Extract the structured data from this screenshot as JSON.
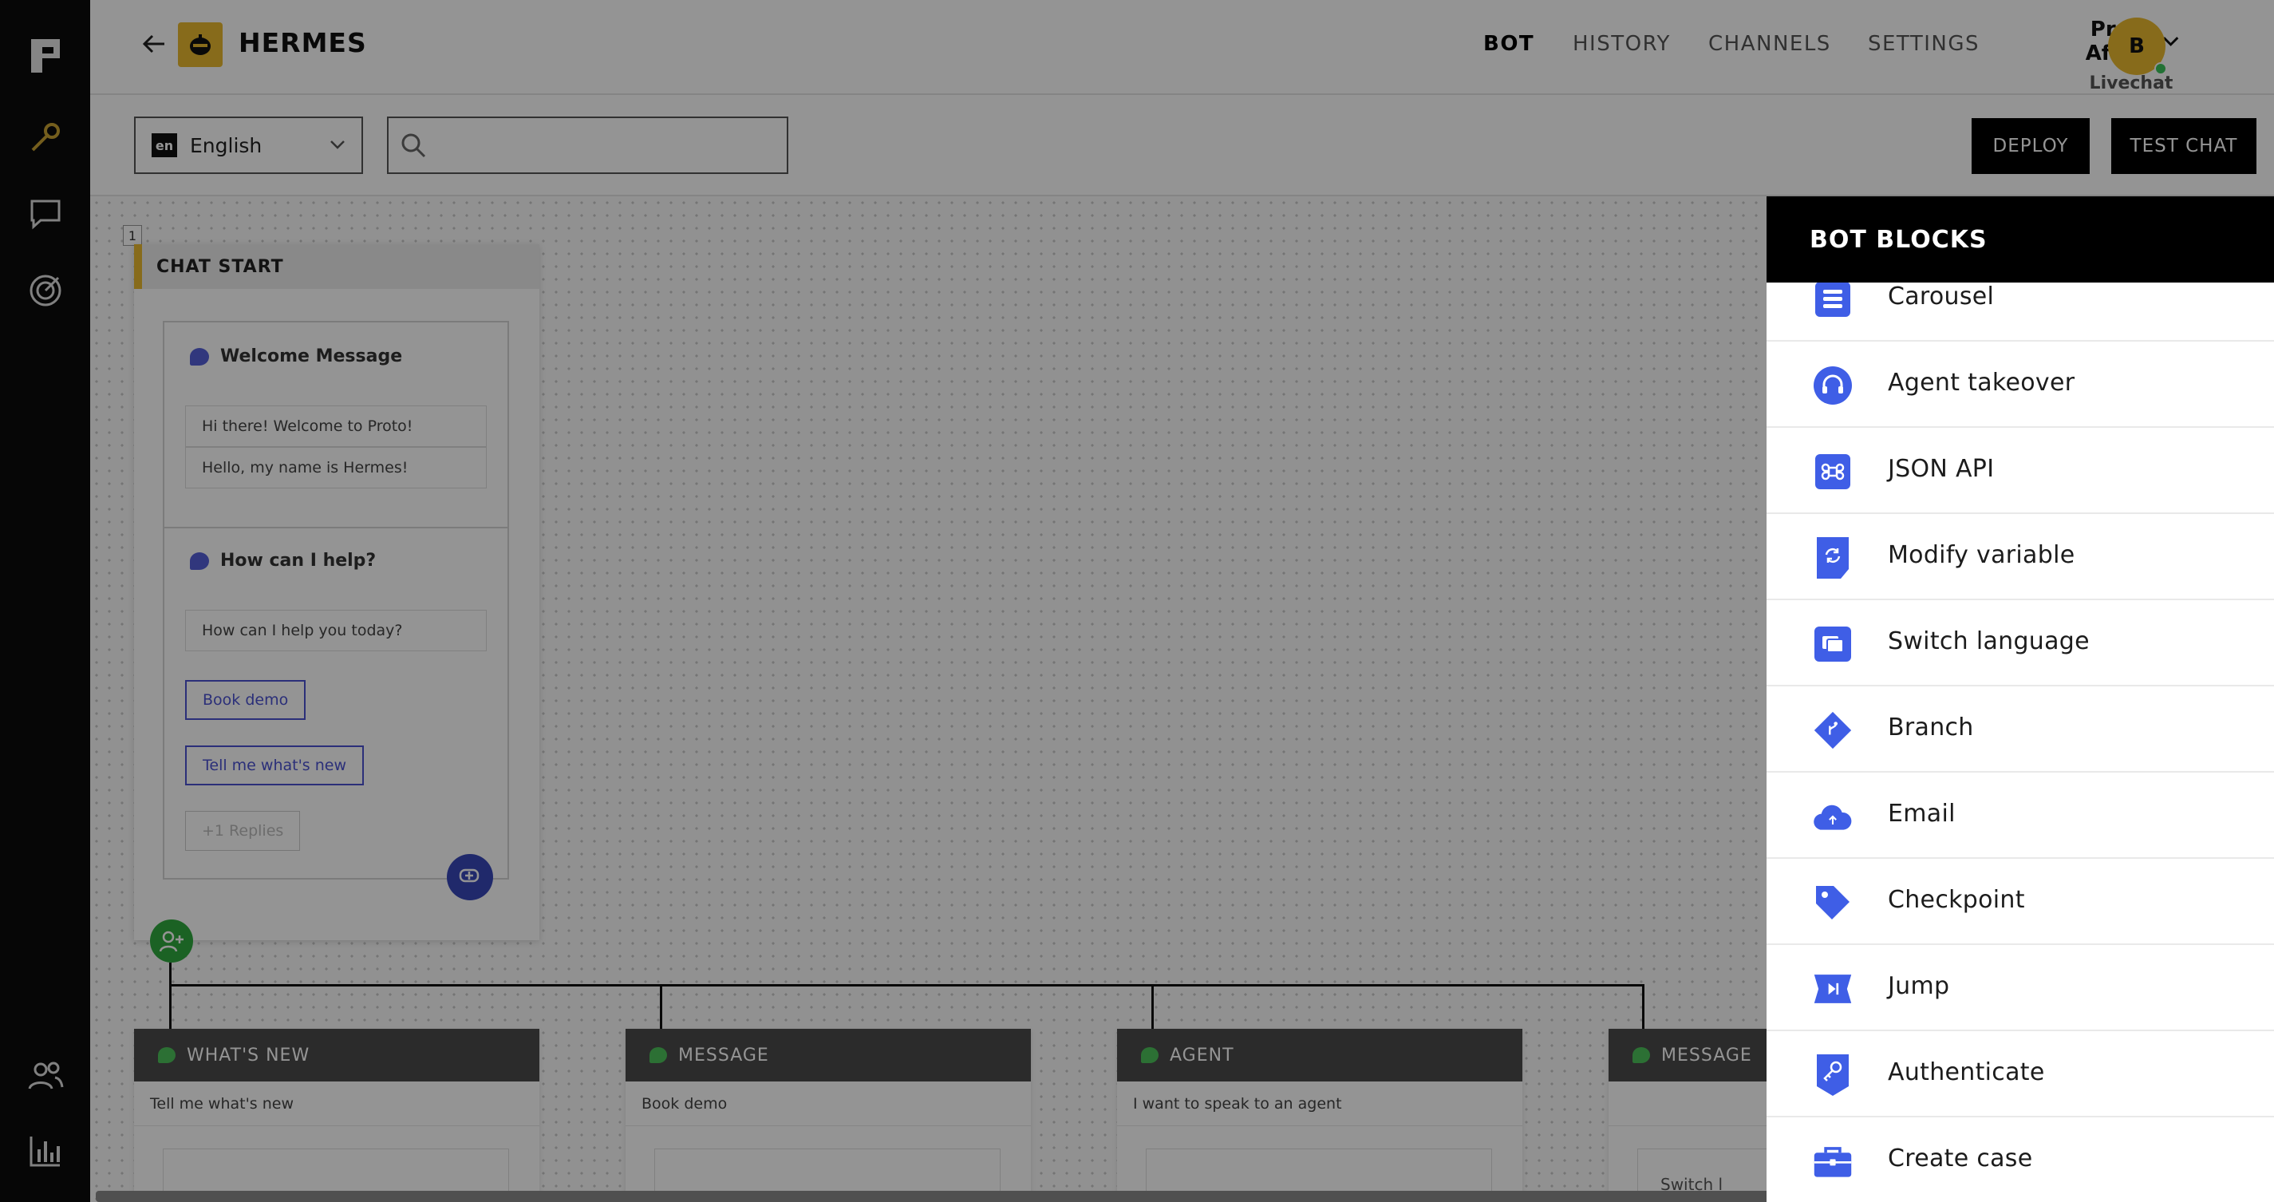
{
  "app": {
    "bot_name": "HERMES",
    "nav": [
      "BOT",
      "HISTORY",
      "CHANNELS",
      "SETTINGS"
    ],
    "active_nav": "BOT",
    "workspace": {
      "name": "Proto Africa",
      "channel": "Livechat"
    },
    "avatar_initial": "B"
  },
  "toolbar": {
    "language_code": "en",
    "language": "English",
    "search_placeholder": "",
    "deploy_label": "DEPLOY",
    "test_chat_label": "TEST CHAT"
  },
  "canvas": {
    "start_index": "1",
    "start_title": "CHAT START",
    "welcome_title": "Welcome Message",
    "welcome_messages": [
      "Hi there! Welcome to Proto!",
      "Hello, my name is Hermes!"
    ],
    "help_title": "How can I help?",
    "help_message": "How can I help you today?",
    "quick_replies": [
      "Book demo",
      "Tell me what's new"
    ],
    "more_replies": "+1 Replies",
    "nodes": [
      {
        "title": "WHAT'S NEW",
        "trigger": "Tell me what's new",
        "sub": ""
      },
      {
        "title": "MESSAGE",
        "trigger": "Book demo",
        "sub": ""
      },
      {
        "title": "AGENT",
        "trigger": "I want to speak to an agent",
        "sub": ""
      },
      {
        "title": "MESSAGE",
        "trigger": "",
        "sub": "Switch l"
      }
    ]
  },
  "panel": {
    "title": "BOT BLOCKS",
    "accent": "#3f5ee6",
    "blocks": [
      {
        "label": "Carousel",
        "icon": "carousel-icon"
      },
      {
        "label": "Agent takeover",
        "icon": "headset-icon"
      },
      {
        "label": "JSON API",
        "icon": "command-icon"
      },
      {
        "label": "Modify variable",
        "icon": "refresh-icon"
      },
      {
        "label": "Switch language",
        "icon": "language-icon"
      },
      {
        "label": "Branch",
        "icon": "branch-icon"
      },
      {
        "label": "Email",
        "icon": "cloud-upload-icon"
      },
      {
        "label": "Checkpoint",
        "icon": "tag-icon"
      },
      {
        "label": "Jump",
        "icon": "skip-icon"
      },
      {
        "label": "Authenticate",
        "icon": "key-icon"
      },
      {
        "label": "Create case",
        "icon": "briefcase-icon"
      }
    ]
  }
}
